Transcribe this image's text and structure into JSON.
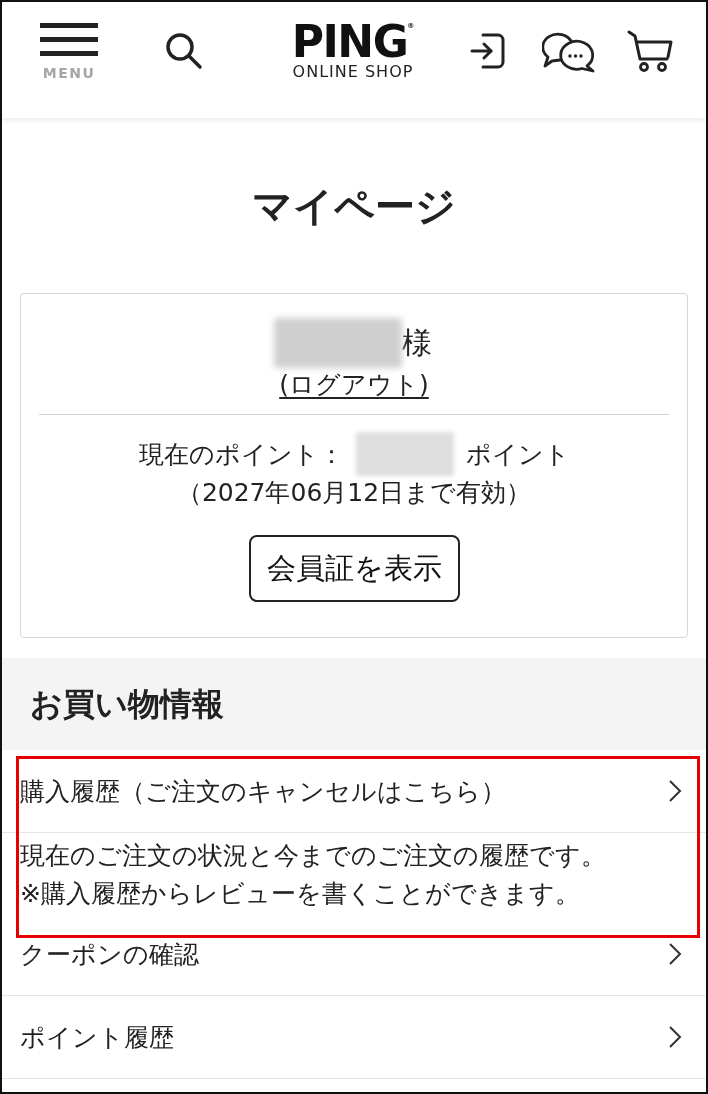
{
  "header": {
    "menu_label": "MENU",
    "logo": {
      "wordmark": "PING$^{®}$",
      "subtitle": "ONLINE SHOP"
    }
  },
  "page_title": "マイページ",
  "member_card": {
    "honorific": "様",
    "logout_link": "(ログアウト)",
    "points_label": "現在のポイント：",
    "points_unit": "ポイント",
    "points_expiry": "（2027年06月12日まで有効）",
    "card_button": "会員証を表示"
  },
  "shopping": {
    "heading": "お買い物情報",
    "items": [
      {
        "label": "購入履歴（ご注文のキャンセルはこちら）",
        "highlighted": true,
        "description": [
          "現在のご注文の状況と今までのご注文の履歴です。",
          "※購入履歴からレビューを書くことができます。"
        ]
      },
      {
        "label": "クーポンの確認",
        "highlighted": false
      },
      {
        "label": "ポイント履歴",
        "highlighted": false
      }
    ]
  }
}
